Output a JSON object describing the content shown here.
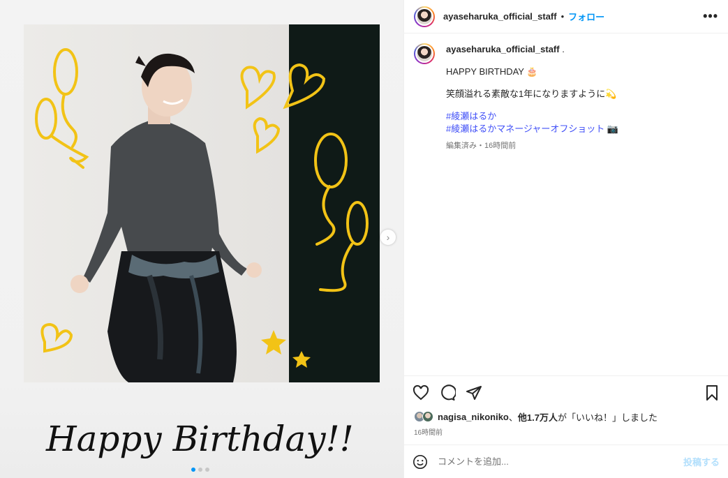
{
  "post": {
    "username": "ayaseharuka_official_staff",
    "follow_label": "フォロー",
    "separator": "•",
    "more_label": "•••"
  },
  "caption": {
    "username": "ayaseharuka_official_staff",
    "username_suffix": " .",
    "line1": "HAPPY BIRTHDAY 🎂",
    "line2": "笑顔溢れる素敵な1年になりますように💫",
    "hashtags": [
      "#綾瀬はるか",
      "#綾瀬はるかマネージャーオフショット 📷"
    ],
    "meta": "編集済み・16時間前"
  },
  "media": {
    "handwriting_text": "Happy Birthday!!",
    "carousel_count": 3,
    "carousel_active": 0,
    "next_arrow": "›"
  },
  "likes": {
    "user": "nagisa_nikoniko",
    "mid": "、",
    "others": "他1.7万人",
    "suffix": "が「いいね！」しました"
  },
  "time_ago": "16時間前",
  "comment": {
    "placeholder": "コメントを追加...",
    "post_label": "投稿する"
  },
  "colors": {
    "link_blue": "#0095f6",
    "hashtag": "#4150f7",
    "gold": "#f2c316"
  }
}
